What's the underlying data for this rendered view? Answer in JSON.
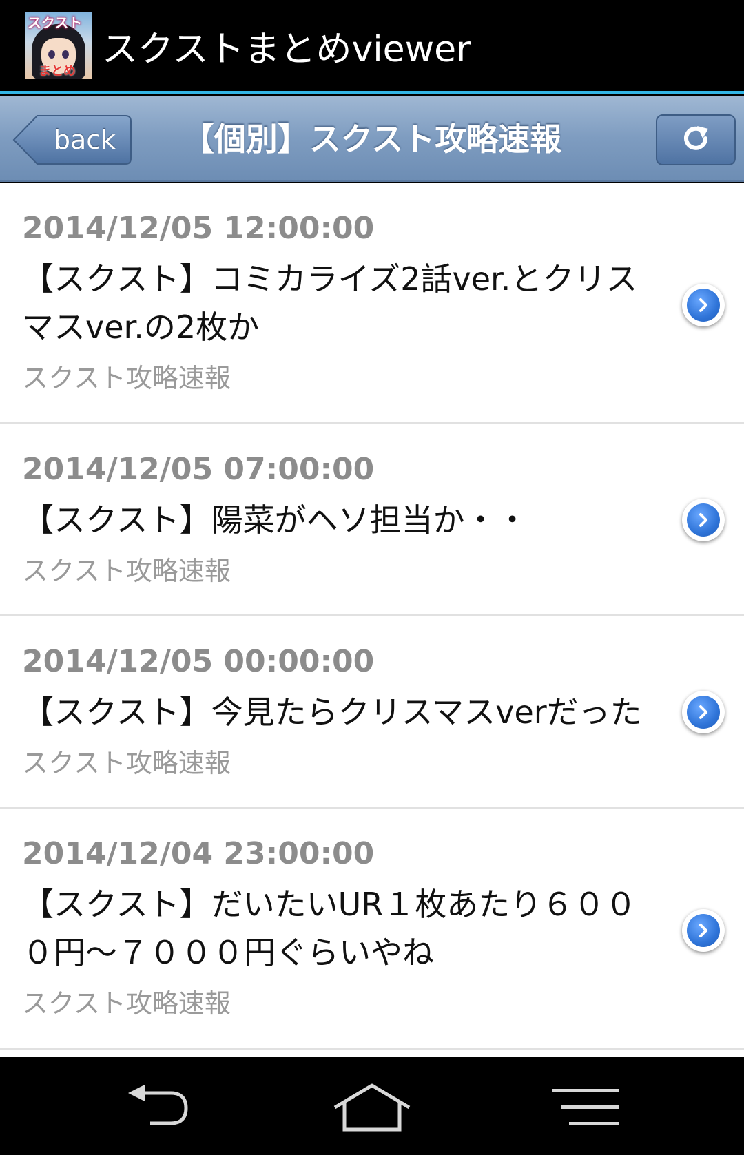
{
  "app": {
    "title": "スクストまとめviewer",
    "icon_label_top": "スクスト",
    "icon_label_bottom": "まとめ"
  },
  "nav": {
    "back_label": "back",
    "title": "【個別】スクスト攻略速報",
    "reload_icon": "reload-icon"
  },
  "colors": {
    "action_bar": "#000000",
    "accent_line": "#33b5e5",
    "nav_bar": "#7e9cc0",
    "date_text": "#8c8c8c",
    "chevron": "#2f74d8"
  },
  "articles": [
    {
      "date": "2014/12/05 12:00:00",
      "title": "【スクスト】コミカライズ2話ver.とクリスマスver.の2枚か",
      "source": "スクスト攻略速報"
    },
    {
      "date": "2014/12/05 07:00:00",
      "title": "【スクスト】陽菜がヘソ担当か・・",
      "source": "スクスト攻略速報"
    },
    {
      "date": "2014/12/05 00:00:00",
      "title": "【スクスト】今見たらクリスマスverだった",
      "source": "スクスト攻略速報"
    },
    {
      "date": "2014/12/04 23:00:00",
      "title": "【スクスト】だいたいUR１枚あたり６０００円～７０００円ぐらいやね",
      "source": "スクスト攻略速報"
    }
  ],
  "system_nav": {
    "back_icon": "system-back-icon",
    "home_icon": "home-icon",
    "menu_icon": "menu-icon"
  }
}
